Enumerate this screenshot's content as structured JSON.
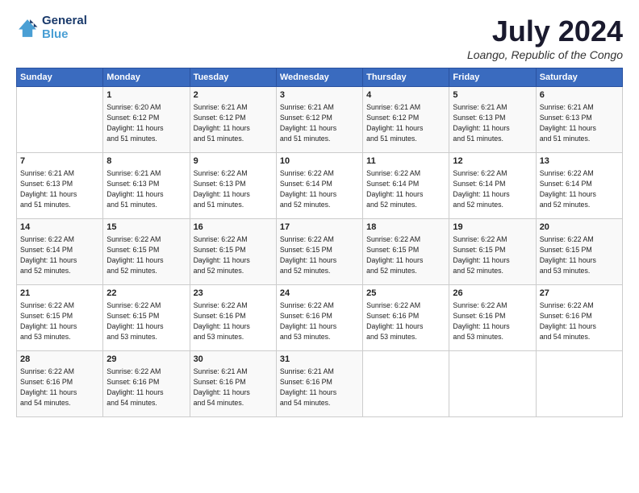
{
  "logo": {
    "line1": "General",
    "line2": "Blue"
  },
  "title": "July 2024",
  "subtitle": "Loango, Republic of the Congo",
  "days_header": [
    "Sunday",
    "Monday",
    "Tuesday",
    "Wednesday",
    "Thursday",
    "Friday",
    "Saturday"
  ],
  "weeks": [
    [
      {
        "day": "",
        "info": ""
      },
      {
        "day": "1",
        "info": "Sunrise: 6:20 AM\nSunset: 6:12 PM\nDaylight: 11 hours\nand 51 minutes."
      },
      {
        "day": "2",
        "info": "Sunrise: 6:21 AM\nSunset: 6:12 PM\nDaylight: 11 hours\nand 51 minutes."
      },
      {
        "day": "3",
        "info": "Sunrise: 6:21 AM\nSunset: 6:12 PM\nDaylight: 11 hours\nand 51 minutes."
      },
      {
        "day": "4",
        "info": "Sunrise: 6:21 AM\nSunset: 6:12 PM\nDaylight: 11 hours\nand 51 minutes."
      },
      {
        "day": "5",
        "info": "Sunrise: 6:21 AM\nSunset: 6:13 PM\nDaylight: 11 hours\nand 51 minutes."
      },
      {
        "day": "6",
        "info": "Sunrise: 6:21 AM\nSunset: 6:13 PM\nDaylight: 11 hours\nand 51 minutes."
      }
    ],
    [
      {
        "day": "7",
        "info": "Sunrise: 6:21 AM\nSunset: 6:13 PM\nDaylight: 11 hours\nand 51 minutes."
      },
      {
        "day": "8",
        "info": "Sunrise: 6:21 AM\nSunset: 6:13 PM\nDaylight: 11 hours\nand 51 minutes."
      },
      {
        "day": "9",
        "info": "Sunrise: 6:22 AM\nSunset: 6:13 PM\nDaylight: 11 hours\nand 51 minutes."
      },
      {
        "day": "10",
        "info": "Sunrise: 6:22 AM\nSunset: 6:14 PM\nDaylight: 11 hours\nand 52 minutes."
      },
      {
        "day": "11",
        "info": "Sunrise: 6:22 AM\nSunset: 6:14 PM\nDaylight: 11 hours\nand 52 minutes."
      },
      {
        "day": "12",
        "info": "Sunrise: 6:22 AM\nSunset: 6:14 PM\nDaylight: 11 hours\nand 52 minutes."
      },
      {
        "day": "13",
        "info": "Sunrise: 6:22 AM\nSunset: 6:14 PM\nDaylight: 11 hours\nand 52 minutes."
      }
    ],
    [
      {
        "day": "14",
        "info": "Sunrise: 6:22 AM\nSunset: 6:14 PM\nDaylight: 11 hours\nand 52 minutes."
      },
      {
        "day": "15",
        "info": "Sunrise: 6:22 AM\nSunset: 6:15 PM\nDaylight: 11 hours\nand 52 minutes."
      },
      {
        "day": "16",
        "info": "Sunrise: 6:22 AM\nSunset: 6:15 PM\nDaylight: 11 hours\nand 52 minutes."
      },
      {
        "day": "17",
        "info": "Sunrise: 6:22 AM\nSunset: 6:15 PM\nDaylight: 11 hours\nand 52 minutes."
      },
      {
        "day": "18",
        "info": "Sunrise: 6:22 AM\nSunset: 6:15 PM\nDaylight: 11 hours\nand 52 minutes."
      },
      {
        "day": "19",
        "info": "Sunrise: 6:22 AM\nSunset: 6:15 PM\nDaylight: 11 hours\nand 52 minutes."
      },
      {
        "day": "20",
        "info": "Sunrise: 6:22 AM\nSunset: 6:15 PM\nDaylight: 11 hours\nand 53 minutes."
      }
    ],
    [
      {
        "day": "21",
        "info": "Sunrise: 6:22 AM\nSunset: 6:15 PM\nDaylight: 11 hours\nand 53 minutes."
      },
      {
        "day": "22",
        "info": "Sunrise: 6:22 AM\nSunset: 6:15 PM\nDaylight: 11 hours\nand 53 minutes."
      },
      {
        "day": "23",
        "info": "Sunrise: 6:22 AM\nSunset: 6:16 PM\nDaylight: 11 hours\nand 53 minutes."
      },
      {
        "day": "24",
        "info": "Sunrise: 6:22 AM\nSunset: 6:16 PM\nDaylight: 11 hours\nand 53 minutes."
      },
      {
        "day": "25",
        "info": "Sunrise: 6:22 AM\nSunset: 6:16 PM\nDaylight: 11 hours\nand 53 minutes."
      },
      {
        "day": "26",
        "info": "Sunrise: 6:22 AM\nSunset: 6:16 PM\nDaylight: 11 hours\nand 53 minutes."
      },
      {
        "day": "27",
        "info": "Sunrise: 6:22 AM\nSunset: 6:16 PM\nDaylight: 11 hours\nand 54 minutes."
      }
    ],
    [
      {
        "day": "28",
        "info": "Sunrise: 6:22 AM\nSunset: 6:16 PM\nDaylight: 11 hours\nand 54 minutes."
      },
      {
        "day": "29",
        "info": "Sunrise: 6:22 AM\nSunset: 6:16 PM\nDaylight: 11 hours\nand 54 minutes."
      },
      {
        "day": "30",
        "info": "Sunrise: 6:21 AM\nSunset: 6:16 PM\nDaylight: 11 hours\nand 54 minutes."
      },
      {
        "day": "31",
        "info": "Sunrise: 6:21 AM\nSunset: 6:16 PM\nDaylight: 11 hours\nand 54 minutes."
      },
      {
        "day": "",
        "info": ""
      },
      {
        "day": "",
        "info": ""
      },
      {
        "day": "",
        "info": ""
      }
    ]
  ]
}
